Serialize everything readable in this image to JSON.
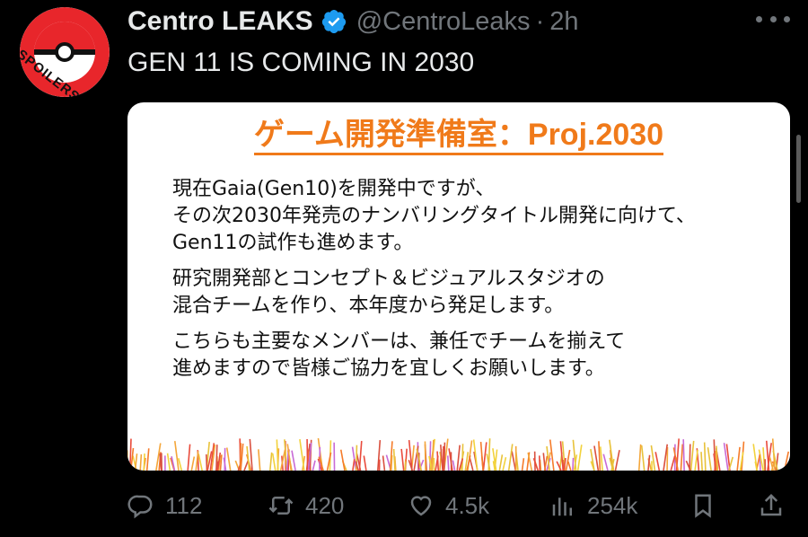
{
  "author": {
    "display_name": "Centro LEAKS",
    "handle": "@CentroLeaks",
    "separator": "·",
    "time": "2h",
    "avatar_text": "SPOILERS"
  },
  "tweet": {
    "text": "GEN 11 IS COMING IN 2030"
  },
  "media": {
    "title": "ゲーム開発準備室：Proj.2030",
    "paragraphs": [
      [
        "現在Gaia(Gen10)を開発中ですが、",
        "その次2030年発売のナンバリングタイトル開発に向けて、",
        "Gen11の試作も進めます。"
      ],
      [
        "研究開発部とコンセプト＆ビジュアルスタジオの",
        "混合チームを作り、本年度から発足します。"
      ],
      [
        "こちらも主要なメンバーは、兼任でチームを揃えて",
        "進めますので皆様ご協力を宜しくお願いします。"
      ]
    ]
  },
  "actions": {
    "replies": "112",
    "reposts": "420",
    "likes": "4.5k",
    "views": "254k"
  },
  "colors": {
    "background": "#000000",
    "text": "#e7e9ea",
    "muted": "#71767b",
    "verified": "#1d9bf0",
    "slide_title": "#f07a1a",
    "avatar_red": "#e8262b"
  },
  "icons": {
    "verified": "verified-badge-icon",
    "more": "more-icon",
    "reply": "reply-icon",
    "repost": "repost-icon",
    "like": "like-icon",
    "views": "views-icon",
    "bookmark": "bookmark-icon",
    "share": "share-icon"
  }
}
